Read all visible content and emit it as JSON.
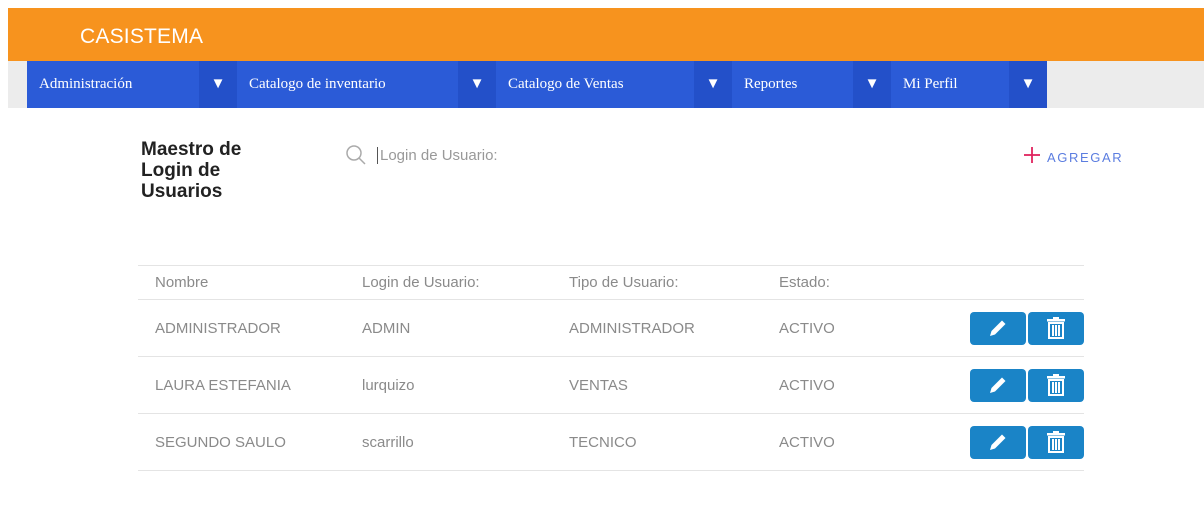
{
  "app": {
    "title": "CASISTEMA"
  },
  "nav": [
    {
      "label": "Administración",
      "arrow": "▼"
    },
    {
      "label": "Catalogo de inventario",
      "arrow": "▼"
    },
    {
      "label": "Catalogo de Ventas",
      "arrow": "▼"
    },
    {
      "label": "Reportes",
      "arrow": "▼"
    },
    {
      "label": "Mi Perfil",
      "arrow": "▼"
    }
  ],
  "page": {
    "title": "Maestro de Login de Usuarios"
  },
  "search": {
    "placeholder": "Login de Usuario:",
    "value": ""
  },
  "add": {
    "label": "AGREGAR"
  },
  "table": {
    "headers": [
      "Nombre",
      "Login de Usuario:",
      "Tipo de Usuario:",
      "Estado:"
    ],
    "rows": [
      {
        "nombre": "ADMINISTRADOR",
        "login": "ADMIN",
        "tipo": "ADMINISTRADOR",
        "estado": "ACTIVO"
      },
      {
        "nombre": "LAURA ESTEFANIA",
        "login": "lurquizo",
        "tipo": "VENTAS",
        "estado": "ACTIVO"
      },
      {
        "nombre": "SEGUNDO SAULO",
        "login": "scarrillo",
        "tipo": "TECNICO",
        "estado": "ACTIVO"
      }
    ]
  },
  "colors": {
    "header": "#f7931e",
    "nav": "#2b5bd7",
    "action": "#1a84c7",
    "add_icon": "#e0245e",
    "add_text": "#5b7de0"
  },
  "icons": {
    "search": "search-icon",
    "add": "plus-icon",
    "edit": "pencil-icon",
    "delete": "trash-icon"
  }
}
